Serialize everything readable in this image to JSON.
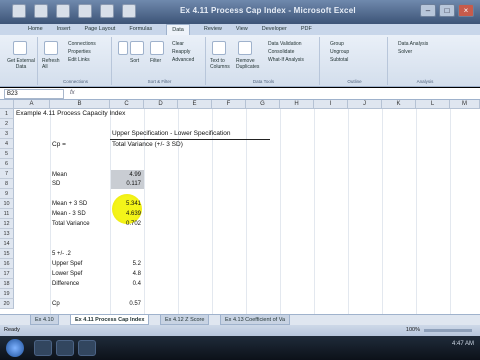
{
  "window": {
    "title": "Ex 4.11 Process Cap Index - Microsoft Excel"
  },
  "ribbon": {
    "tabs": [
      "Home",
      "Insert",
      "Page Layout",
      "Formulas",
      "Data",
      "Review",
      "View",
      "Developer",
      "PDF"
    ],
    "active_tab": "Data",
    "groups": {
      "get_external": {
        "label": "Get External Data",
        "button": "Get External Data"
      },
      "connections": {
        "label": "Connections",
        "refresh": "Refresh All",
        "items": [
          "Connections",
          "Properties",
          "Edit Links"
        ]
      },
      "sort_filter": {
        "label": "Sort & Filter",
        "sort": "Sort",
        "filter": "Filter",
        "items": [
          "Clear",
          "Reapply",
          "Advanced"
        ]
      },
      "data_tools": {
        "label": "Data Tools",
        "text_to_columns": "Text to Columns",
        "remove_dup": "Remove Duplicates",
        "items": [
          "Data Validation",
          "Consolidate",
          "What-If Analysis"
        ]
      },
      "outline": {
        "label": "Outline",
        "items": [
          "Group",
          "Ungroup",
          "Subtotal"
        ]
      },
      "analysis": {
        "label": "Analysis",
        "items": [
          "Data Analysis",
          "Solver"
        ]
      }
    }
  },
  "formula_bar": {
    "name_box": "B23",
    "fx": "fx"
  },
  "columns": [
    "A",
    "B",
    "C",
    "D",
    "E",
    "F",
    "G",
    "H",
    "I",
    "J",
    "K",
    "L",
    "M"
  ],
  "rows": [
    "1",
    "2",
    "3",
    "4",
    "5",
    "6",
    "7",
    "8",
    "9",
    "10",
    "11",
    "12",
    "13",
    "14",
    "15",
    "16",
    "17",
    "18",
    "19",
    "20"
  ],
  "sheet": {
    "title": "Example 4.11 Process Capacity Index",
    "numerator": "Upper Specification - Lower Specification",
    "cp_label": "Cp =",
    "denominator": "Total Variance  (+/- 3 SD)",
    "mean_label": "Mean",
    "mean_value": "4.99",
    "sd_label": "SD",
    "sd_value": "0.117",
    "mean_plus_label": "Mean + 3 SD",
    "mean_plus_value": "5.341",
    "mean_minus_label": "Mean - 3 SD",
    "mean_minus_value": "4.639",
    "total_var_label": "Total Variance",
    "total_var_value": "0.702",
    "spec_label": "5 +/- .2",
    "upper_spec_label": "Upper Spef",
    "upper_spec_value": "5.2",
    "lower_spec_label": "Lower Spef",
    "lower_spec_value": "4.8",
    "difference_label": "Difference",
    "difference_value": "0.4",
    "cp_result_label": "Cp",
    "cp_result_value": "0.57"
  },
  "sheet_tabs": [
    "Ex 4.10",
    "Ex 4.11 Process Cap Index",
    "Ex 4.12 Z Score",
    "Ex 4.13 Coefficient of Va"
  ],
  "active_sheet": "Ex 4.11 Process Cap Index",
  "status": {
    "ready": "Ready",
    "zoom": "100%"
  },
  "clock": {
    "time": "4:47 AM"
  },
  "colors": {
    "highlight": "#f4f30d",
    "shaded_cells": "#c9cdd3",
    "ribbon": "#dce6f2"
  }
}
